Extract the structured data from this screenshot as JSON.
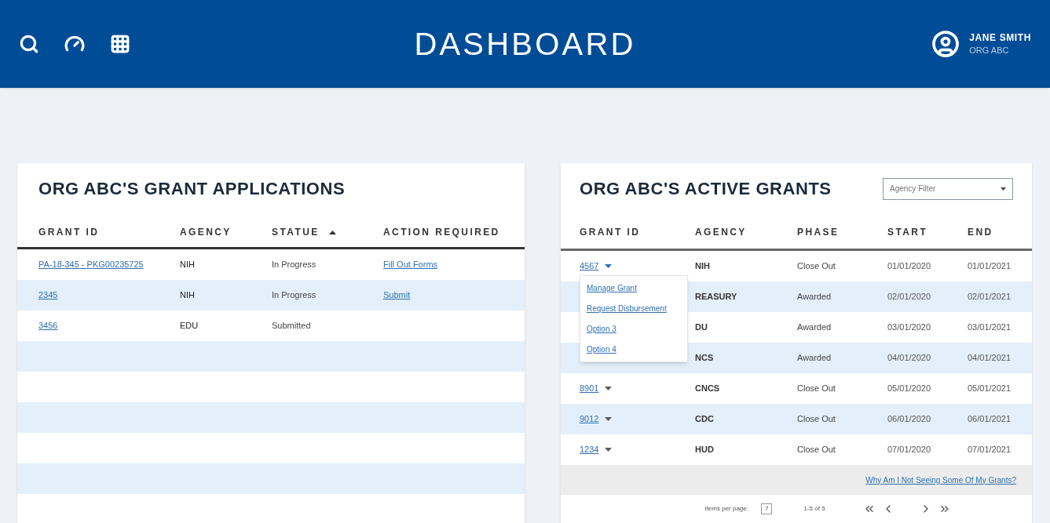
{
  "header": {
    "title": "DASHBOARD",
    "user_name": "JANE SMITH",
    "user_org": "ORG ABC"
  },
  "applications": {
    "title": "ORG ABC'S GRANT APPLICATIONS",
    "columns": [
      {
        "label": "GRANT ID",
        "sorted": false
      },
      {
        "label": "AGENCY",
        "sorted": false
      },
      {
        "label": "STATUE",
        "sorted": true
      },
      {
        "label": "ACTION REQUIRED",
        "sorted": false
      }
    ],
    "rows": [
      {
        "grant_id": "PA-18-345 - PKG00235725",
        "agency": "NIH",
        "status": "In Progress",
        "action": "Fill Out Forms"
      },
      {
        "grant_id": "2345",
        "agency": "NIH",
        "status": "In Progress",
        "action": "Submit"
      },
      {
        "grant_id": "3456",
        "agency": "EDU",
        "status": "Submitted"
      }
    ]
  },
  "active_grants": {
    "title": "ORG ABC'S ACTIVE GRANTS",
    "filter": {
      "placeholder": "Agency Filter"
    },
    "columns": [
      "GRANT ID",
      "AGENCY",
      "PHASE",
      "START",
      "END"
    ],
    "rows": [
      {
        "grant_id": "4567",
        "expanded": true,
        "agency": "NIH",
        "phase": "Close Out",
        "start": "01/01/2020",
        "end": "01/01/2021"
      },
      {
        "agency": "REASURY",
        "phase": "Awarded",
        "start": "02/01/2020",
        "end": "02/01/2021"
      },
      {
        "agency": "DU",
        "phase": "Awarded",
        "start": "03/01/2020",
        "end": "03/01/2021"
      },
      {
        "agency": "NCS",
        "phase": "Awarded",
        "start": "04/01/2020",
        "end": "04/01/2021"
      },
      {
        "grant_id": "8901",
        "expanded": false,
        "agency": "CNCS",
        "phase": "Close Out",
        "start": "05/01/2020",
        "end": "05/01/2021"
      },
      {
        "grant_id": "9012",
        "expanded": false,
        "agency": "CDC",
        "phase": "Close Out",
        "start": "06/01/2020",
        "end": "06/01/2021"
      },
      {
        "grant_id": "1234",
        "expanded": false,
        "agency": "HUD",
        "phase": "Close Out",
        "start": "07/01/2020",
        "end": "07/01/2021"
      }
    ],
    "menu": [
      "Manage Grant",
      "Request Disbursement",
      "Option 3",
      "Option 4"
    ],
    "help_link": "Why Am I Not Seeing Some Of My Grants?",
    "pagination": {
      "items_label": "Items per page:",
      "items_value": "7",
      "range": "1-5 of 5"
    }
  }
}
